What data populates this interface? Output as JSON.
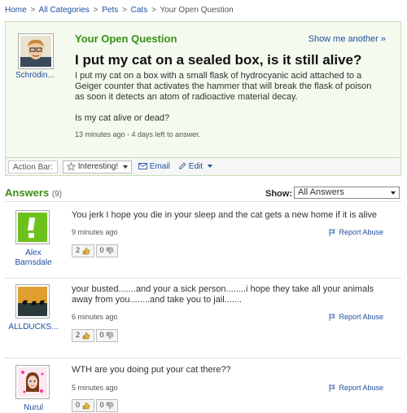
{
  "breadcrumb": [
    {
      "label": "Home"
    },
    {
      "label": "All Categories"
    },
    {
      "label": "Pets"
    },
    {
      "label": "Cats"
    },
    {
      "label": "Your Open Question",
      "current": true
    }
  ],
  "breadcrumb_sep": ">",
  "question": {
    "section_title": "Your Open Question",
    "show_more": "Show me another »",
    "asker": "Schrödin...",
    "title": "I put my cat on a sealed box, is it still alive?",
    "body_1": "I put my cat on a box with a small flask of hydrocyanic acid attached to a Geiger counter that activates the hammer that will break the flask of poison as soon it detects an atom of radioactive material decay.",
    "body_2": "Is my cat alive or dead?",
    "meta": "13 minutes ago - 4 days left to answer."
  },
  "action_bar": {
    "label": "Action Bar:",
    "interesting": "Interesting!",
    "email": "Email",
    "edit": "Edit"
  },
  "answers_header": {
    "title": "Answers",
    "count": "(9)",
    "show_label": "Show:",
    "show_value": "All Answers"
  },
  "answers": [
    {
      "author": "Alex Barnsdale",
      "text": "You jerk I hope you die in your sleep and the cat gets a new home if it is alive",
      "time": "9 minutes ago",
      "thumbs_up": "2",
      "thumbs_down": "0",
      "report": "Report Abuse"
    },
    {
      "author": "ALLDUCKS...",
      "text": "your busted.......and your a sick person........i hope they take all your animals away from you........and take you to jail.......",
      "time": "6 minutes ago",
      "thumbs_up": "2",
      "thumbs_down": "0",
      "report": "Report Abuse"
    },
    {
      "author": "Nurul",
      "text": "WTH are you doing put your cat there??",
      "time": "5 minutes ago",
      "thumbs_up": "0",
      "thumbs_down": "0",
      "report": "Report Abuse"
    }
  ],
  "colors": {
    "accent_green": "#3a8e16",
    "link_blue": "#1e4e9e",
    "question_bg": "#f4faee"
  }
}
